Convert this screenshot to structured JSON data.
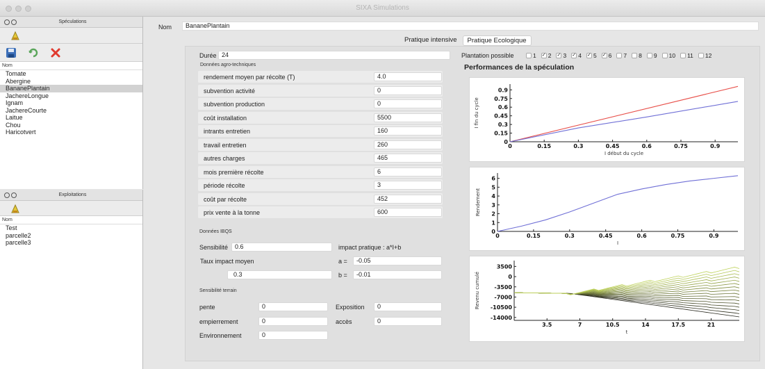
{
  "window": {
    "title": "SIXA Simulations"
  },
  "speculations_panel": {
    "title": "Spéculations",
    "list_header": "Nom",
    "items": [
      "Tomate",
      "Abergine",
      "BananePlantain",
      "JachereLongue",
      "Ignam",
      "JachereCourte",
      "Laitue",
      "Chou",
      "Haricotvert"
    ],
    "selected": "BananePlantain"
  },
  "exploitations_panel": {
    "title": "Exploitations",
    "list_header": "Nom",
    "items": [
      "Test",
      "parcelle2",
      "parcelle3"
    ]
  },
  "header": {
    "nom_label": "Nom",
    "nom_value": "BananePlantain"
  },
  "tabs": [
    {
      "label": "Pratique intensive",
      "active": false
    },
    {
      "label": "Pratique Ecologique",
      "active": true
    }
  ],
  "duree": {
    "label": "Durée",
    "value": "24"
  },
  "plantation": {
    "label": "Plantation possible",
    "months": [
      {
        "n": "1",
        "checked": false
      },
      {
        "n": "2",
        "checked": true
      },
      {
        "n": "3",
        "checked": true
      },
      {
        "n": "4",
        "checked": true
      },
      {
        "n": "5",
        "checked": true
      },
      {
        "n": "6",
        "checked": true
      },
      {
        "n": "7",
        "checked": false
      },
      {
        "n": "8",
        "checked": false
      },
      {
        "n": "9",
        "checked": false
      },
      {
        "n": "10",
        "checked": false
      },
      {
        "n": "11",
        "checked": false
      },
      {
        "n": "12",
        "checked": false
      }
    ]
  },
  "agro": {
    "title": "Données agro-techniques",
    "rows": [
      {
        "label": "rendement moyen par récolte (T)",
        "value": "4.0"
      },
      {
        "label": "subvention activité",
        "value": "0"
      },
      {
        "label": "subvention production",
        "value": "0"
      },
      {
        "label": "coût installation",
        "value": "5500"
      },
      {
        "label": "intrants entretien",
        "value": "160"
      },
      {
        "label": "travail entretien",
        "value": "260"
      },
      {
        "label": "autres charges",
        "value": "465"
      },
      {
        "label": "mois première récolte",
        "value": "6"
      },
      {
        "label": "période récolte",
        "value": "3"
      },
      {
        "label": "coût par récolte",
        "value": "452"
      },
      {
        "label": "prix vente à la tonne",
        "value": "600"
      }
    ]
  },
  "ibqs": {
    "title": "Données IBQS",
    "sensibilite_label": "Sensibilité",
    "sensibilite_value": "0.6",
    "impact_label": "impact pratique : a*I+b",
    "taux_label": "Taux impact moyen",
    "taux_value": "0.3",
    "a_label": "a =",
    "a_value": "-0.05",
    "b_label": "b =",
    "b_value": "-0.01"
  },
  "terrain": {
    "title": "Sensibilité terrain",
    "pente_label": "pente",
    "pente_value": "0",
    "exposition_label": "Exposition",
    "exposition_value": "0",
    "empierrement_label": "empierrement",
    "empierrement_value": "0",
    "acces_label": "accès",
    "acces_value": "0",
    "environnement_label": "Environnement",
    "environnement_value": "0"
  },
  "perf_title": "Performances de la spéculation",
  "colors": {
    "red_series": "#e8504a",
    "blue_series": "#6f6fd6"
  },
  "chart_data": [
    {
      "type": "line",
      "xlabel": "I début du cycle",
      "ylabel": "I fin du cycle",
      "xlim": [
        0,
        1
      ],
      "ylim": [
        0,
        1
      ],
      "x_ticks": [
        "0",
        "0.15",
        "0.3",
        "0.45",
        "0.6",
        "0.75",
        "0.9"
      ],
      "y_ticks": [
        "0",
        "0.15",
        "0.3",
        "0.45",
        "0.6",
        "0.75",
        "0.9"
      ],
      "series": [
        {
          "color": "#e8504a",
          "x": [
            0,
            1
          ],
          "y": [
            0,
            0.96
          ]
        },
        {
          "color": "#6f6fd6",
          "x": [
            0,
            0.3,
            0.6,
            1.0
          ],
          "y": [
            0,
            0.24,
            0.43,
            0.7
          ]
        }
      ]
    },
    {
      "type": "line",
      "xlabel": "I",
      "ylabel": "Rendement",
      "xlim": [
        0,
        1
      ],
      "ylim": [
        0,
        6.6
      ],
      "x_ticks": [
        "0",
        "0.15",
        "0.3",
        "0.45",
        "0.6",
        "0.75",
        "0.9"
      ],
      "y_ticks": [
        "0",
        "1",
        "2",
        "3",
        "4",
        "5",
        "6"
      ],
      "series": [
        {
          "color": "#6f6fd6",
          "x": [
            0,
            0.1,
            0.2,
            0.3,
            0.4,
            0.5,
            0.6,
            0.7,
            0.8,
            0.9,
            1.0
          ],
          "y": [
            0,
            0.6,
            1.3,
            2.2,
            3.2,
            4.2,
            4.8,
            5.3,
            5.7,
            6.0,
            6.3
          ]
        }
      ]
    },
    {
      "type": "line",
      "xlabel": "t",
      "ylabel": "Revenu cumulé",
      "xlim": [
        0,
        24
      ],
      "ylim": [
        -15000,
        5500
      ],
      "x_ticks": [
        "3.5",
        "7",
        "10.5",
        "14",
        "17.5",
        "21"
      ],
      "y_ticks": [
        "3500",
        "0",
        "-3500",
        "-7000",
        "-10500",
        "-14000"
      ],
      "series_count": 16,
      "start_value": -5500,
      "end_range": [
        -13800,
        3200
      ]
    }
  ]
}
